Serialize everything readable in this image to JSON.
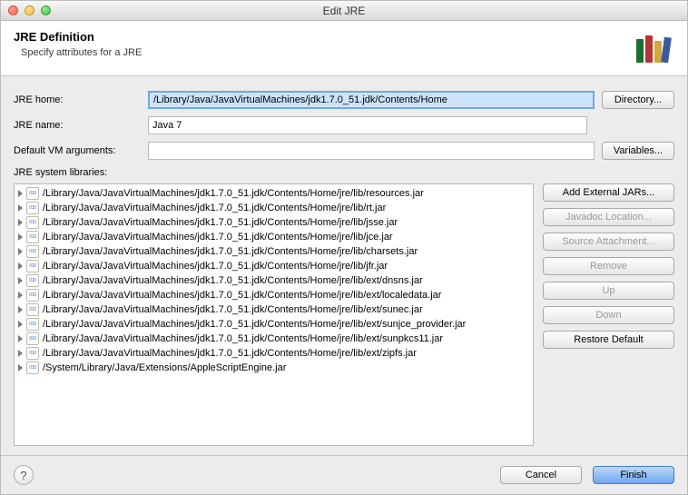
{
  "window": {
    "title": "Edit JRE"
  },
  "header": {
    "title": "JRE Definition",
    "subtitle": "Specify attributes for a JRE"
  },
  "fields": {
    "jre_home_label": "JRE home:",
    "jre_home_value": "/Library/Java/JavaVirtualMachines/jdk1.7.0_51.jdk/Contents/Home",
    "jre_name_label": "JRE name:",
    "jre_name_value": "Java 7",
    "vm_args_label": "Default VM arguments:",
    "vm_args_value": "",
    "lib_label": "JRE system libraries:"
  },
  "buttons": {
    "directory": "Directory...",
    "variables": "Variables...",
    "add_external": "Add External JARs...",
    "javadoc": "Javadoc Location...",
    "source": "Source Attachment...",
    "remove": "Remove",
    "up": "Up",
    "down": "Down",
    "restore": "Restore Default",
    "cancel": "Cancel",
    "finish": "Finish"
  },
  "libraries": [
    "/Library/Java/JavaVirtualMachines/jdk1.7.0_51.jdk/Contents/Home/jre/lib/resources.jar",
    "/Library/Java/JavaVirtualMachines/jdk1.7.0_51.jdk/Contents/Home/jre/lib/rt.jar",
    "/Library/Java/JavaVirtualMachines/jdk1.7.0_51.jdk/Contents/Home/jre/lib/jsse.jar",
    "/Library/Java/JavaVirtualMachines/jdk1.7.0_51.jdk/Contents/Home/jre/lib/jce.jar",
    "/Library/Java/JavaVirtualMachines/jdk1.7.0_51.jdk/Contents/Home/jre/lib/charsets.jar",
    "/Library/Java/JavaVirtualMachines/jdk1.7.0_51.jdk/Contents/Home/jre/lib/jfr.jar",
    "/Library/Java/JavaVirtualMachines/jdk1.7.0_51.jdk/Contents/Home/jre/lib/ext/dnsns.jar",
    "/Library/Java/JavaVirtualMachines/jdk1.7.0_51.jdk/Contents/Home/jre/lib/ext/localedata.jar",
    "/Library/Java/JavaVirtualMachines/jdk1.7.0_51.jdk/Contents/Home/jre/lib/ext/sunec.jar",
    "/Library/Java/JavaVirtualMachines/jdk1.7.0_51.jdk/Contents/Home/jre/lib/ext/sunjce_provider.jar",
    "/Library/Java/JavaVirtualMachines/jdk1.7.0_51.jdk/Contents/Home/jre/lib/ext/sunpkcs11.jar",
    "/Library/Java/JavaVirtualMachines/jdk1.7.0_51.jdk/Contents/Home/jre/lib/ext/zipfs.jar",
    "/System/Library/Java/Extensions/AppleScriptEngine.jar"
  ]
}
